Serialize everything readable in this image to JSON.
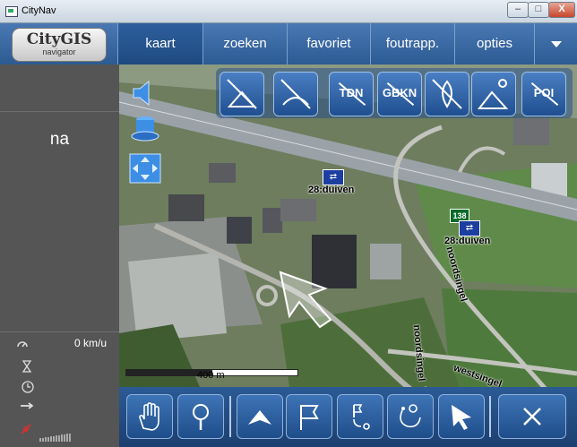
{
  "window": {
    "title": "CityNav",
    "minimize_label": "–",
    "maximize_label": "□",
    "close_label": "X"
  },
  "logo": {
    "title": "CityGIS",
    "subtitle": "navigator"
  },
  "tabs": [
    {
      "label": "kaart",
      "active": true
    },
    {
      "label": "zoeken",
      "active": false
    },
    {
      "label": "favoriet",
      "active": false
    },
    {
      "label": "foutrapp.",
      "active": false
    },
    {
      "label": "opties",
      "active": false
    }
  ],
  "sidebar": {
    "current_street": "na",
    "speed": "0 km/u"
  },
  "map": {
    "layer_buttons": [
      {
        "label": "",
        "icon": "layer-toggle-1-icon"
      },
      {
        "label": "",
        "icon": "layer-toggle-2-icon"
      },
      {
        "label": "TDN",
        "icon": "tdn-icon"
      },
      {
        "label": "GBKN",
        "icon": "gbkn-icon"
      },
      {
        "label": "",
        "icon": "fire-dept-icon"
      },
      {
        "label": "",
        "icon": "satellite-icon"
      },
      {
        "label": "POI",
        "icon": "poi-icon"
      }
    ],
    "poi_labels": [
      "28:duiven",
      "28:duiven"
    ],
    "route_number": "138",
    "street_labels": [
      "noordsingel",
      "noordsingel",
      "westsingel"
    ],
    "scale_label": "400 m"
  },
  "toolbar": {
    "close_label": "✕"
  },
  "colors": {
    "accent": "#2c5a93",
    "sidebar_bg": "#555555"
  }
}
